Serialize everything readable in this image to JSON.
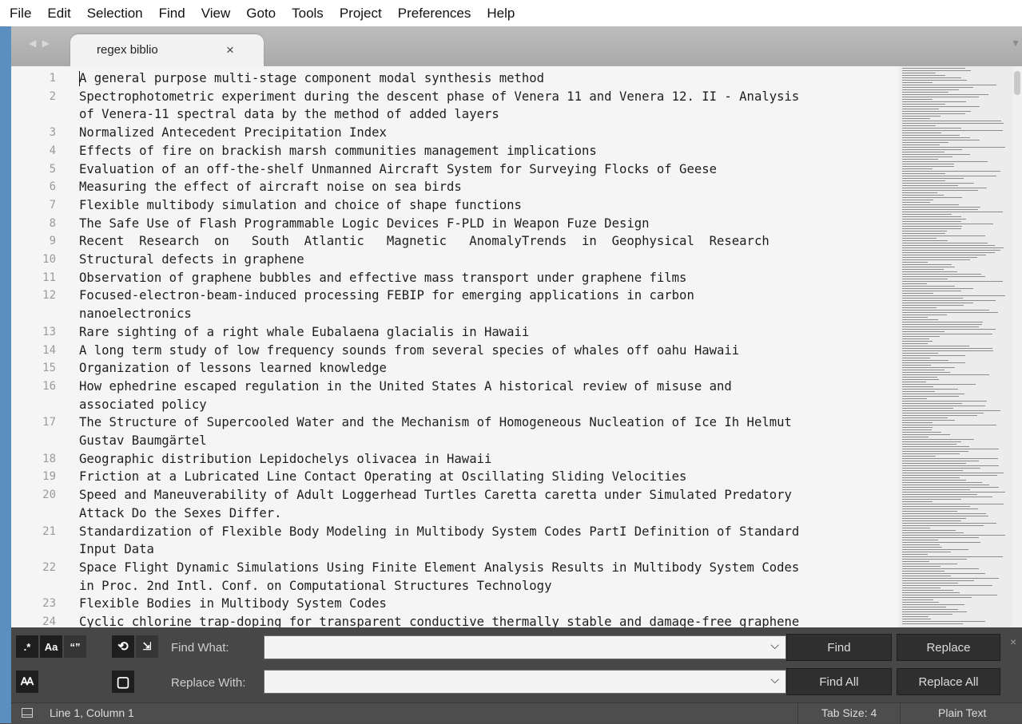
{
  "menu": [
    "File",
    "Edit",
    "Selection",
    "Find",
    "View",
    "Goto",
    "Tools",
    "Project",
    "Preferences",
    "Help"
  ],
  "tab": {
    "title": "regex biblio",
    "close": "×"
  },
  "editor": {
    "lines": [
      {
        "n": "1",
        "text": [
          "A general purpose multi-stage component modal synthesis method"
        ]
      },
      {
        "n": "2",
        "text": [
          "Spectrophotometric experiment during the descent phase of Venera 11 and Venera 12. II - Analysis",
          "of Venera-11 spectral data by the method of added layers"
        ]
      },
      {
        "n": "3",
        "text": [
          "Normalized Antecedent Precipitation Index"
        ]
      },
      {
        "n": "4",
        "text": [
          "Effects of fire on brackish marsh communities management implications"
        ]
      },
      {
        "n": "5",
        "text": [
          "Evaluation of an off-the-shelf Unmanned Aircraft System for Surveying Flocks of Geese"
        ]
      },
      {
        "n": "6",
        "text": [
          "Measuring the effect of aircraft noise on sea birds"
        ]
      },
      {
        "n": "7",
        "text": [
          "Flexible multibody simulation and choice of shape functions"
        ]
      },
      {
        "n": "8",
        "text": [
          "The Safe Use of Flash Programmable Logic Devices F-PLD in Weapon Fuze Design"
        ]
      },
      {
        "n": "9",
        "text": [
          "Recent  Research  on   South  Atlantic   Magnetic   AnomalyTrends  in  Geophysical  Research"
        ]
      },
      {
        "n": "10",
        "text": [
          "Structural defects in graphene"
        ]
      },
      {
        "n": "11",
        "text": [
          "Observation of graphene bubbles and effective mass transport under graphene films"
        ]
      },
      {
        "n": "12",
        "text": [
          "Focused-electron-beam-induced processing FEBIP for emerging applications in carbon",
          "nanoelectronics"
        ]
      },
      {
        "n": "13",
        "text": [
          "Rare sighting of a right whale Eubalaena glacialis in Hawaii"
        ]
      },
      {
        "n": "14",
        "text": [
          "A long term study of low frequency sounds from several species of whales off oahu Hawaii"
        ]
      },
      {
        "n": "15",
        "text": [
          "Organization of lessons learned knowledge"
        ]
      },
      {
        "n": "16",
        "text": [
          "How ephedrine escaped regulation in the United States A historical review of misuse and",
          "associated policy"
        ]
      },
      {
        "n": "17",
        "text": [
          "The Structure of Supercooled Water and the Mechanism of Homogeneous Nucleation of Ice Ih Helmut",
          "Gustav Baumgärtel"
        ]
      },
      {
        "n": "18",
        "text": [
          "Geographic distribution Lepidochelys olivacea in Hawaii"
        ]
      },
      {
        "n": "19",
        "text": [
          "Friction at a Lubricated Line Contact Operating at Oscillating Sliding Velocities"
        ]
      },
      {
        "n": "20",
        "text": [
          "Speed and Maneuverability of Adult Loggerhead Turtles Caretta caretta under Simulated Predatory",
          "Attack Do the Sexes Differ."
        ]
      },
      {
        "n": "21",
        "text": [
          "Standardization of Flexible Body Modeling in Multibody System Codes PartI Definition of Standard",
          "Input Data"
        ]
      },
      {
        "n": "22",
        "text": [
          "Space Flight Dynamic Simulations Using Finite Element Analysis Results in Multibody System Codes",
          "in Proc. 2nd Intl. Conf. on Computational Structures Technology"
        ]
      },
      {
        "n": "23",
        "text": [
          "Flexible Bodies in Multibody System Codes"
        ]
      },
      {
        "n": "24",
        "text": [
          "Cyclic chlorine trap-doping for transparent conductive thermally stable and damage-free graphene"
        ]
      }
    ]
  },
  "find_panel": {
    "options": [
      {
        "name": "regex-toggle",
        "glyph": ".*"
      },
      {
        "name": "case-sensitive-toggle",
        "glyph": "Aa"
      },
      {
        "name": "whole-word-toggle",
        "glyph": "“”"
      },
      {
        "name": "wrap-toggle",
        "glyph": "⟲"
      },
      {
        "name": "in-selection-toggle",
        "glyph": "⇲"
      },
      {
        "name": "preserve-case-toggle",
        "glyph": "Ꜳ"
      },
      {
        "name": "highlight-matches-toggle",
        "glyph": "▢"
      }
    ],
    "find_label": "Find What:",
    "replace_label": "Replace With:",
    "find_value": "",
    "replace_value": "",
    "find_button": "Find",
    "replace_button": "Replace",
    "find_all_button": "Find All",
    "replace_all_button": "Replace All",
    "close": "×"
  },
  "status": {
    "position": "Line 1, Column 1",
    "tab_size": "Tab Size: 4",
    "syntax": "Plain Text"
  }
}
